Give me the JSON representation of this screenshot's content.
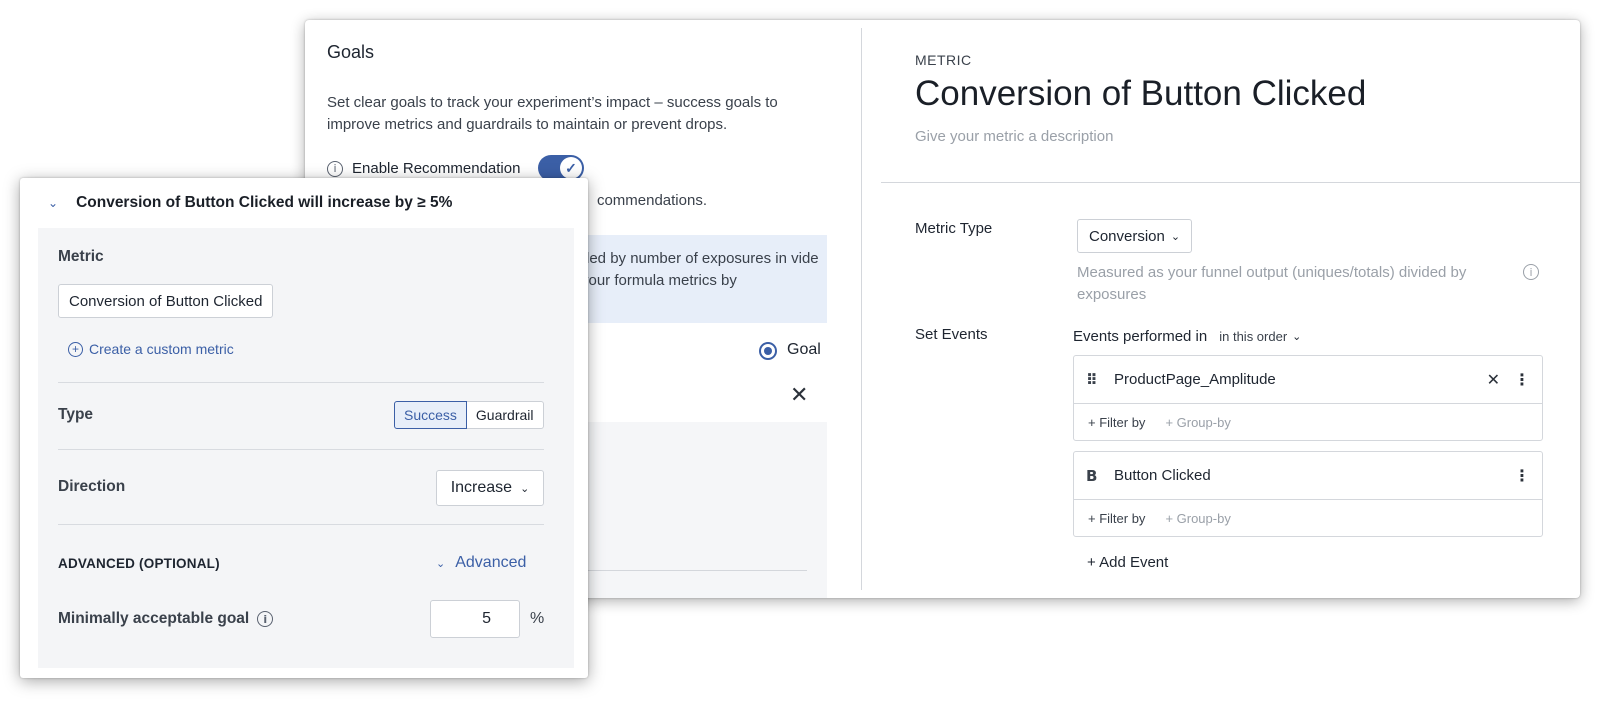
{
  "goals": {
    "title": "Goals",
    "description": "Set clear goals to track your experiment’s impact – success goals to improve metrics and guardrails to maintain or prevent drops.",
    "enable_recommendation_label": "Enable Recommendation",
    "recommendation_enabled": true,
    "recommendation_note": "commendations.",
    "info_text": "ded by number of exposures in vide your formula metrics by",
    "goal_radio_label": "Goal"
  },
  "metric": {
    "eyebrow": "METRIC",
    "title": "Conversion of Button Clicked",
    "description_placeholder": "Give your metric a description",
    "metric_type_label": "Metric Type",
    "metric_type_value": "Conversion",
    "metric_type_description": "Measured as your funnel output (uniques/totals) divided by exposures",
    "set_events_label": "Set Events",
    "events_performed_label": "Events performed in",
    "order_value": "in this order",
    "events": [
      {
        "marker": "⠿",
        "name": "ProductPage_Amplitude",
        "filter_label": "+ Filter by",
        "group_label": "+ Group-by"
      },
      {
        "marker": "B",
        "name": "Button Clicked",
        "filter_label": "+ Filter by",
        "group_label": "+ Group-by"
      }
    ],
    "add_event_label": "+ Add Event"
  },
  "goal_panel": {
    "header": "Conversion of Button Clicked will increase by ≥ 5%",
    "metric_label": "Metric",
    "metric_value": "Conversion of Button Clicked",
    "create_custom_metric": "Create a custom metric",
    "type_label": "Type",
    "type_options": [
      "Success",
      "Guardrail"
    ],
    "type_selected": "Success",
    "direction_label": "Direction",
    "direction_value": "Increase",
    "advanced_label": "ADVANCED (OPTIONAL)",
    "advanced_link": "Advanced",
    "min_goal_label": "Minimally acceptable goal",
    "min_goal_value": "5",
    "min_goal_unit": "%"
  },
  "colors": {
    "accent": "#3b5fa6",
    "accent_light": "#e7eef9",
    "panel_bg": "#f4f5f7"
  }
}
